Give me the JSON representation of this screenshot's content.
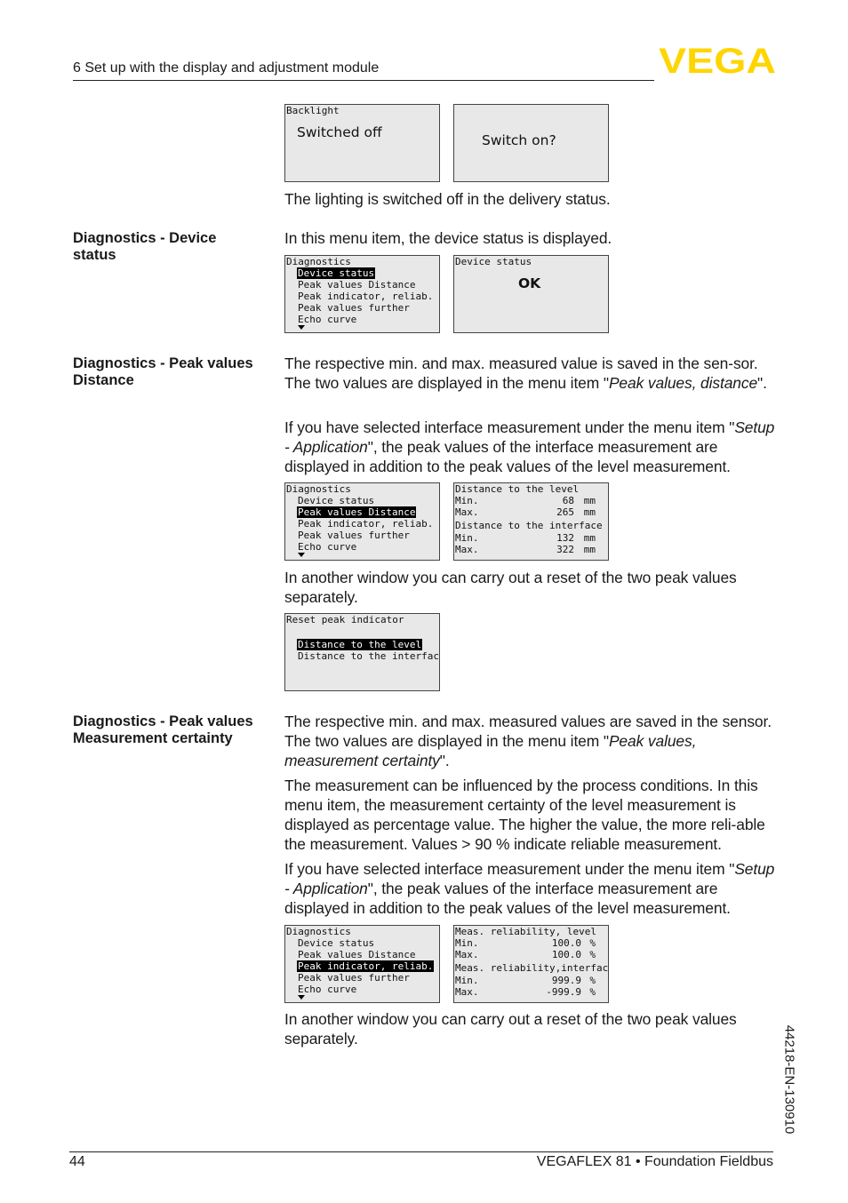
{
  "header": {
    "section_title": "6 Set up with the display and adjustment module",
    "logo_text": "VEGA",
    "logo_color": "#FFD500"
  },
  "footer": {
    "page_number": "44",
    "document_title": "VEGAFLEX 81 • Foundation Fieldbus",
    "side_code": "44218-EN-130910"
  },
  "backlight": {
    "screen1": {
      "title": "Backlight",
      "value": "Switched off"
    },
    "screen2": {
      "value": "Switch on?"
    },
    "caption": "The lighting is switched off in the delivery status."
  },
  "device_status": {
    "label": "Diagnostics - Device status",
    "text": "In this menu item, the device status is displayed.",
    "menu": {
      "title": "Diagnostics",
      "items": [
        "Device status",
        "Peak values Distance",
        "Peak indicator, reliab.",
        "Peak values further",
        "Echo curve"
      ],
      "selected_index": 0
    },
    "screen2": {
      "title": "Device status",
      "value": "OK"
    }
  },
  "peak_distance": {
    "label": "Diagnostics - Peak values Distance",
    "p1_a": "The respective min. and max. measured value is saved in the sen-sor. The two values are displayed in the menu item \"",
    "p1_em": "Peak values, distance",
    "p1_b": "\".",
    "p2_a": "If you have selected interface measurement under the menu item \"",
    "p2_em": "Setup - Application",
    "p2_b": "\", the peak values of the interface measurement are displayed in addition to the peak values of the level measurement.",
    "menu": {
      "title": "Diagnostics",
      "items": [
        "Device status",
        "Peak values Distance",
        "Peak indicator, reliab.",
        "Peak values further",
        "Echo curve"
      ],
      "selected_index": 1
    },
    "values_screen": {
      "group1_title": "Distance to the level",
      "group1_rows": [
        {
          "label": "Min.",
          "value": "68",
          "unit": "mm"
        },
        {
          "label": "Max.",
          "value": "265",
          "unit": "mm"
        }
      ],
      "group2_title": "Distance to the interface",
      "group2_rows": [
        {
          "label": "Min.",
          "value": "132",
          "unit": "mm"
        },
        {
          "label": "Max.",
          "value": "322",
          "unit": "mm"
        }
      ]
    },
    "reset_text": "In another window you can carry out a reset of the two peak values separately.",
    "reset_screen": {
      "title": "Reset peak indicator",
      "items": [
        "Distance to the level",
        "Distance to the interface"
      ],
      "selected_index": 0
    }
  },
  "peak_certainty": {
    "label": "Diagnostics - Peak values Measurement certainty",
    "p1_a": "The respective min. and max. measured values are saved in the sensor. The two values are displayed in the menu item \"",
    "p1_em": "Peak values, measurement certainty",
    "p1_b": "\".",
    "p2": "The measurement can be influenced by the process conditions. In this menu item, the measurement certainty of the level measurement is displayed as percentage value. The higher the value, the more reli-able the measurement. Values > 90 % indicate reliable measurement.",
    "p3_a": "If you have selected interface measurement under the menu item \"",
    "p3_em": "Setup - Application",
    "p3_b": "\", the peak values of the interface measurement are displayed in addition to the peak values of the level measurement.",
    "menu": {
      "title": "Diagnostics",
      "items": [
        "Device status",
        "Peak values Distance",
        "Peak indicator, reliab.",
        "Peak values further",
        "Echo curve"
      ],
      "selected_index": 2
    },
    "values_screen": {
      "group1_title": "Meas. reliability, level",
      "group1_rows": [
        {
          "label": "Min.",
          "value": "100.0",
          "unit": "%"
        },
        {
          "label": "Max.",
          "value": "100.0",
          "unit": "%"
        }
      ],
      "group2_title": "Meas. reliability,interface",
      "group2_rows": [
        {
          "label": "Min.",
          "value": "999.9",
          "unit": "%"
        },
        {
          "label": "Max.",
          "value": "-999.9",
          "unit": "%"
        }
      ]
    },
    "reset_text": "In another window you can carry out a reset of the two peak values separately."
  }
}
